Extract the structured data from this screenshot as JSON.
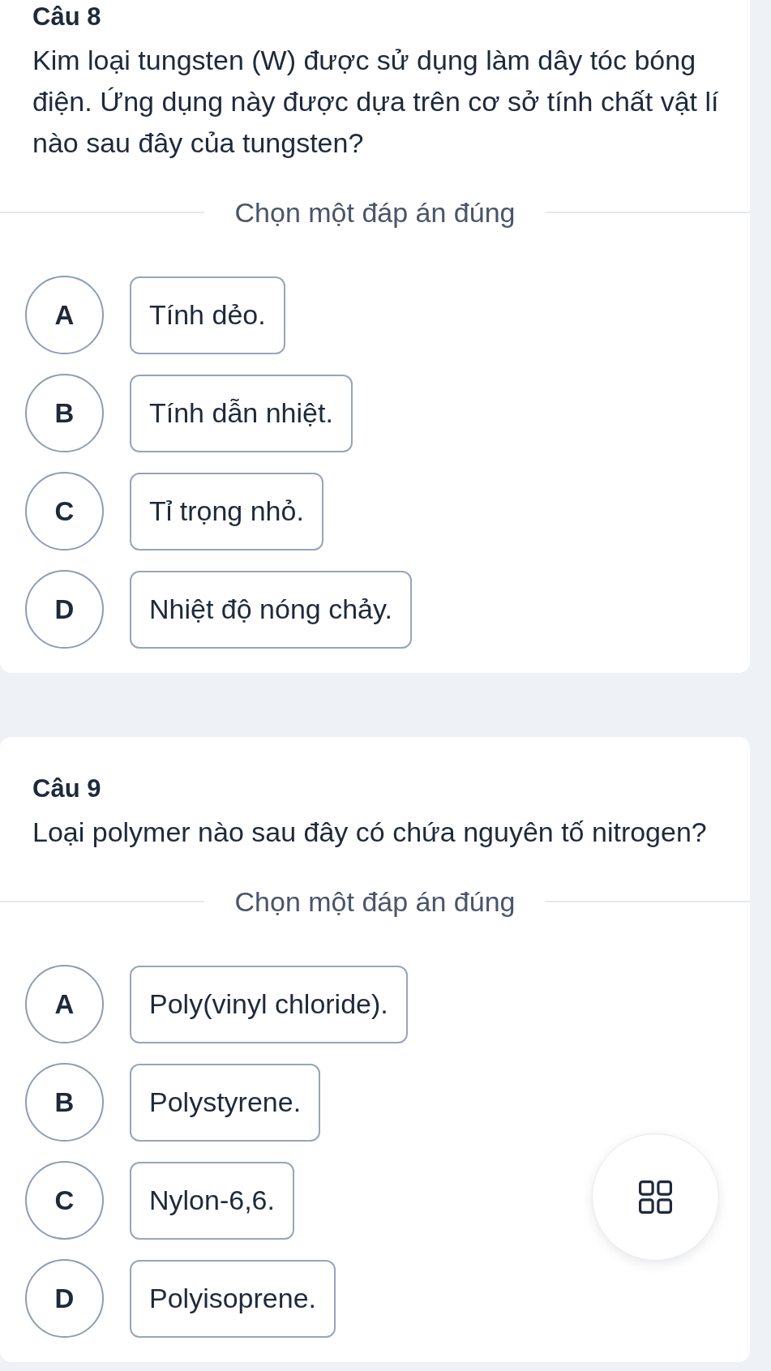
{
  "questions": [
    {
      "number": "Câu 8",
      "text": "Kim loại tungsten (W) được sử dụng làm dây tóc bóng điện. Ứng dụng này được dựa trên cơ sở tính chất vật lí nào sau đây của tungsten?",
      "prompt": "Chọn một đáp án đúng",
      "options": [
        {
          "letter": "A",
          "text": "Tính dẻo.",
          "selected": false
        },
        {
          "letter": "B",
          "text": "Tính dẫn nhiệt.",
          "selected": false
        },
        {
          "letter": "C",
          "text": "Tỉ trọng nhỏ.",
          "selected": false
        },
        {
          "letter": "D",
          "text": "Nhiệt độ nóng chảy.",
          "selected": false
        }
      ]
    },
    {
      "number": "Câu 9",
      "text": "Loại polymer nào sau đây có chứa nguyên tố nitrogen?",
      "prompt": "Chọn một đáp án đúng",
      "options": [
        {
          "letter": "A",
          "text": "Poly(vinyl chloride).",
          "selected": false
        },
        {
          "letter": "B",
          "text": "Polystyrene.",
          "selected": false
        },
        {
          "letter": "C",
          "text": "Nylon-6,6.",
          "selected": false
        },
        {
          "letter": "D",
          "text": "Polyisoprene.",
          "selected": false
        }
      ]
    }
  ]
}
